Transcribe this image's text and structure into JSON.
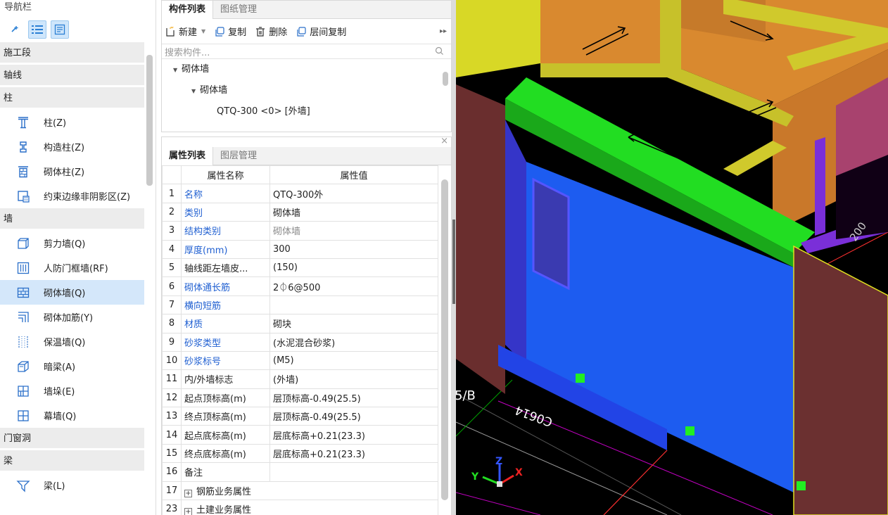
{
  "nav": {
    "title": "导航栏",
    "categories": {
      "c1": "施工段",
      "c2": "轴线",
      "c3": "柱",
      "c4": "墙",
      "c5": "门窗洞",
      "c6": "梁"
    },
    "items": [
      {
        "label": "柱(Z)",
        "icon": "column-icon"
      },
      {
        "label": "构造柱(Z)",
        "icon": "constructional-column-icon"
      },
      {
        "label": "砌体柱(Z)",
        "icon": "masonry-column-icon"
      },
      {
        "label": "约束边缘非阴影区(Z)",
        "icon": "constraint-edge-icon"
      },
      {
        "label": "剪力墙(Q)",
        "icon": "shear-wall-icon"
      },
      {
        "label": "人防门框墙(RF)",
        "icon": "civil-defense-door-frame-wall-icon"
      },
      {
        "label": "砌体墙(Q)",
        "icon": "masonry-wall-icon",
        "selected": true
      },
      {
        "label": "砌体加筋(Y)",
        "icon": "masonry-reinforcement-icon"
      },
      {
        "label": "保温墙(Q)",
        "icon": "insulation-wall-icon"
      },
      {
        "label": "暗梁(A)",
        "icon": "hidden-beam-icon"
      },
      {
        "label": "墙垛(E)",
        "icon": "wall-pier-icon"
      },
      {
        "label": "幕墙(Q)",
        "icon": "curtain-wall-icon"
      },
      {
        "label": "梁(L)",
        "icon": "beam-icon"
      }
    ]
  },
  "component_panel": {
    "tabs": [
      "构件列表",
      "图纸管理"
    ],
    "toolbar": {
      "new": "新建",
      "copy": "复制",
      "delete": "删除",
      "floor_copy": "层间复制"
    },
    "search_placeholder": "搜索构件...",
    "tree": {
      "root": "砌体墙",
      "child": "砌体墙",
      "leaf": "QTQ-300 <0> [外墙]"
    }
  },
  "property_panel": {
    "tabs": [
      "属性列表",
      "图层管理"
    ],
    "headers": {
      "num": "",
      "name": "属性名称",
      "value": "属性值"
    },
    "rows": [
      {
        "num": "1",
        "name": "名称",
        "value": "QTQ-300外"
      },
      {
        "num": "2",
        "name": "类别",
        "value": "砌体墙"
      },
      {
        "num": "3",
        "name": "结构类别",
        "value": "砌体墙"
      },
      {
        "num": "4",
        "name": "厚度(mm)",
        "value": "300"
      },
      {
        "num": "5",
        "name": "轴线距左墙皮...",
        "value": "(150)"
      },
      {
        "num": "6",
        "name": "砌体通长筋",
        "value": "2⏀6@500"
      },
      {
        "num": "7",
        "name": "横向短筋",
        "value": ""
      },
      {
        "num": "8",
        "name": "材质",
        "value": "砌块"
      },
      {
        "num": "9",
        "name": "砂浆类型",
        "value": "(水泥混合砂浆)"
      },
      {
        "num": "10",
        "name": "砂浆标号",
        "value": "(M5)"
      },
      {
        "num": "11",
        "name": "内/外墙标志",
        "value": "(外墙)"
      },
      {
        "num": "12",
        "name": "起点顶标高(m)",
        "value": "层顶标高-0.49(25.5)"
      },
      {
        "num": "13",
        "name": "终点顶标高(m)",
        "value": "层顶标高-0.49(25.5)"
      },
      {
        "num": "14",
        "name": "起点底标高(m)",
        "value": "层底标高+0.21(23.3)"
      },
      {
        "num": "15",
        "name": "终点底标高(m)",
        "value": "层底标高+0.21(23.3)"
      },
      {
        "num": "16",
        "name": "备注",
        "value": ""
      },
      {
        "num": "17",
        "name": "钢筋业务属性",
        "value": ""
      },
      {
        "num": "23",
        "name": "土建业务属性",
        "value": ""
      }
    ]
  },
  "viewport": {
    "axis_label": "5/B",
    "dimension_label": "C0614",
    "dimension_label_2": "200",
    "axis_x": "X",
    "axis_y": "Y",
    "axis_z": "Z"
  }
}
